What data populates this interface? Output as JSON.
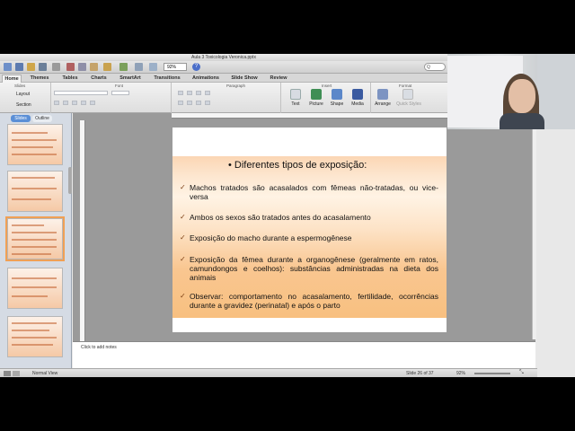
{
  "window": {
    "title": "Aula 3 Toxicologia Veronica.pptx"
  },
  "toolbar": {
    "zoom": "92%",
    "help": "?",
    "search_placeholder": "Q"
  },
  "ribbon": {
    "tabs": [
      "Home",
      "Themes",
      "Tables",
      "Charts",
      "SmartArt",
      "Transitions",
      "Animations",
      "Slide Show",
      "Review"
    ],
    "active_tab": "Home",
    "groups": [
      "Slides",
      "Font",
      "Paragraph",
      "Insert",
      "Format"
    ],
    "layout_label": "Layout",
    "section_label": "Section",
    "insert_items": [
      "Text",
      "Picture",
      "Shape",
      "Media"
    ],
    "format_items": [
      "Arrange",
      "Quick Styles"
    ]
  },
  "left_panel": {
    "tabs": [
      "Slides",
      "Outline"
    ],
    "active_tab": "Slides"
  },
  "slide": {
    "title": "Diferentes tipos de exposição:",
    "bullet_symbol": "✓",
    "bullets": [
      "Machos tratados são acasalados com fêmeas não-tratadas, ou vice-versa",
      "Ambos os sexos são tratados antes do acasalamento",
      "Exposição do macho durante a espermogênese",
      "Exposição da fêmea durante a organogênese (geralmente em ratos, camundongos e coelhos): substâncias administradas na dieta dos animais",
      "Observar: comportamento no acasalamento, fertilidade, ocorrências durante a gravidez (perinatal) e após o parto"
    ]
  },
  "notes": {
    "placeholder": "Click to add notes"
  },
  "status": {
    "view": "Normal View",
    "slide_counter": "Slide 26 of 37",
    "zoom": "92%"
  }
}
